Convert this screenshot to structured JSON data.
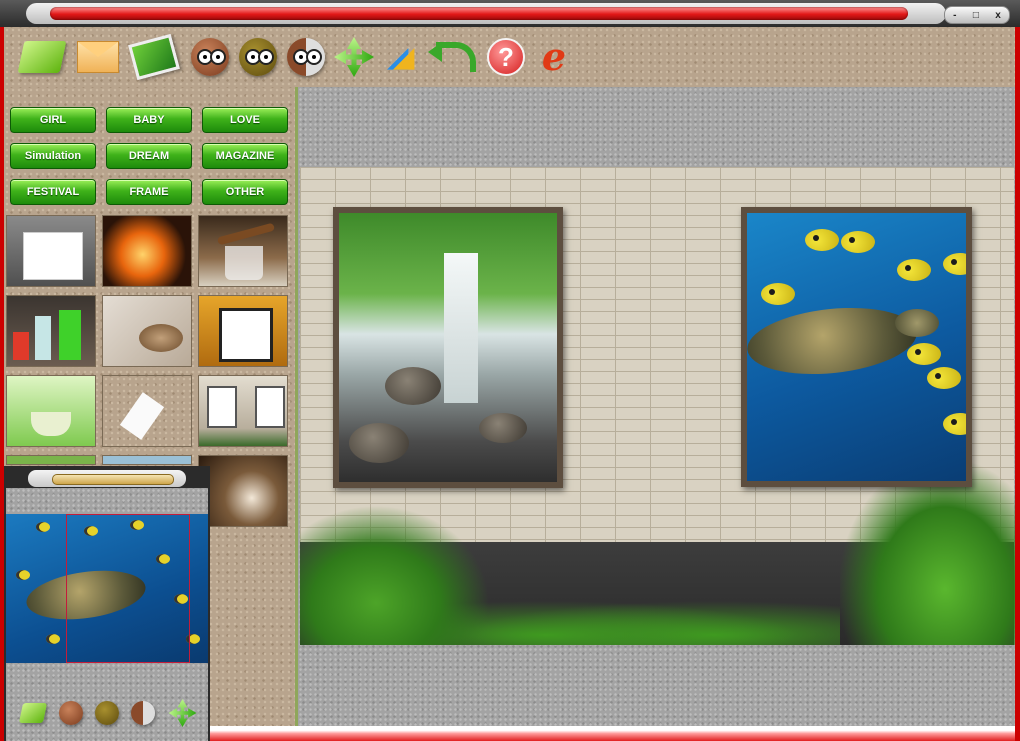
{
  "window": {
    "controls": {
      "minimize": "-",
      "restore": "□",
      "close": "x"
    }
  },
  "toolbar": {
    "items": [
      {
        "icon": "open-folder-icon"
      },
      {
        "icon": "envelope-icon"
      },
      {
        "icon": "photo-edit-icon"
      },
      {
        "icon": "owl-face-icon"
      },
      {
        "icon": "owl-face-olive-icon"
      },
      {
        "icon": "owl-face-half-icon"
      },
      {
        "icon": "move-arrows-icon"
      },
      {
        "icon": "rotate-icon"
      },
      {
        "icon": "undo-arrow-icon"
      },
      {
        "icon": "help-icon",
        "label": "?"
      },
      {
        "icon": "internet-explorer-icon",
        "label": "e"
      }
    ]
  },
  "categories": [
    "GIRL",
    "BABY",
    "LOVE",
    "Simulation",
    "DREAM",
    "MAGAZINE",
    "FESTIVAL",
    "FRAME",
    "OTHER"
  ],
  "templates": [
    "blank-card-template",
    "fire-coin-template",
    "cigar-glass-template",
    "colored-drinks-template",
    "coffee-cup-template",
    "calendar-template",
    "green-tea-template",
    "paper-tag-template",
    "stone-wall-frames-template",
    "partial-template-1",
    "partial-template-2",
    "lamp-template"
  ],
  "preview": {
    "tools": [
      "open-folder-icon",
      "owl-face-icon",
      "owl-face-olive-icon",
      "owl-face-half-icon",
      "move-arrows-icon"
    ]
  },
  "canvas": {
    "scene": "stone-wall-with-two-frames",
    "frames": [
      "waterfall-photo",
      "sea-turtle-photo"
    ]
  },
  "colors": {
    "accent_red": "#e21818",
    "button_green": "#3fb21a",
    "panel_sand": "#b8a48d",
    "panel_gray": "#a3a3a3"
  }
}
